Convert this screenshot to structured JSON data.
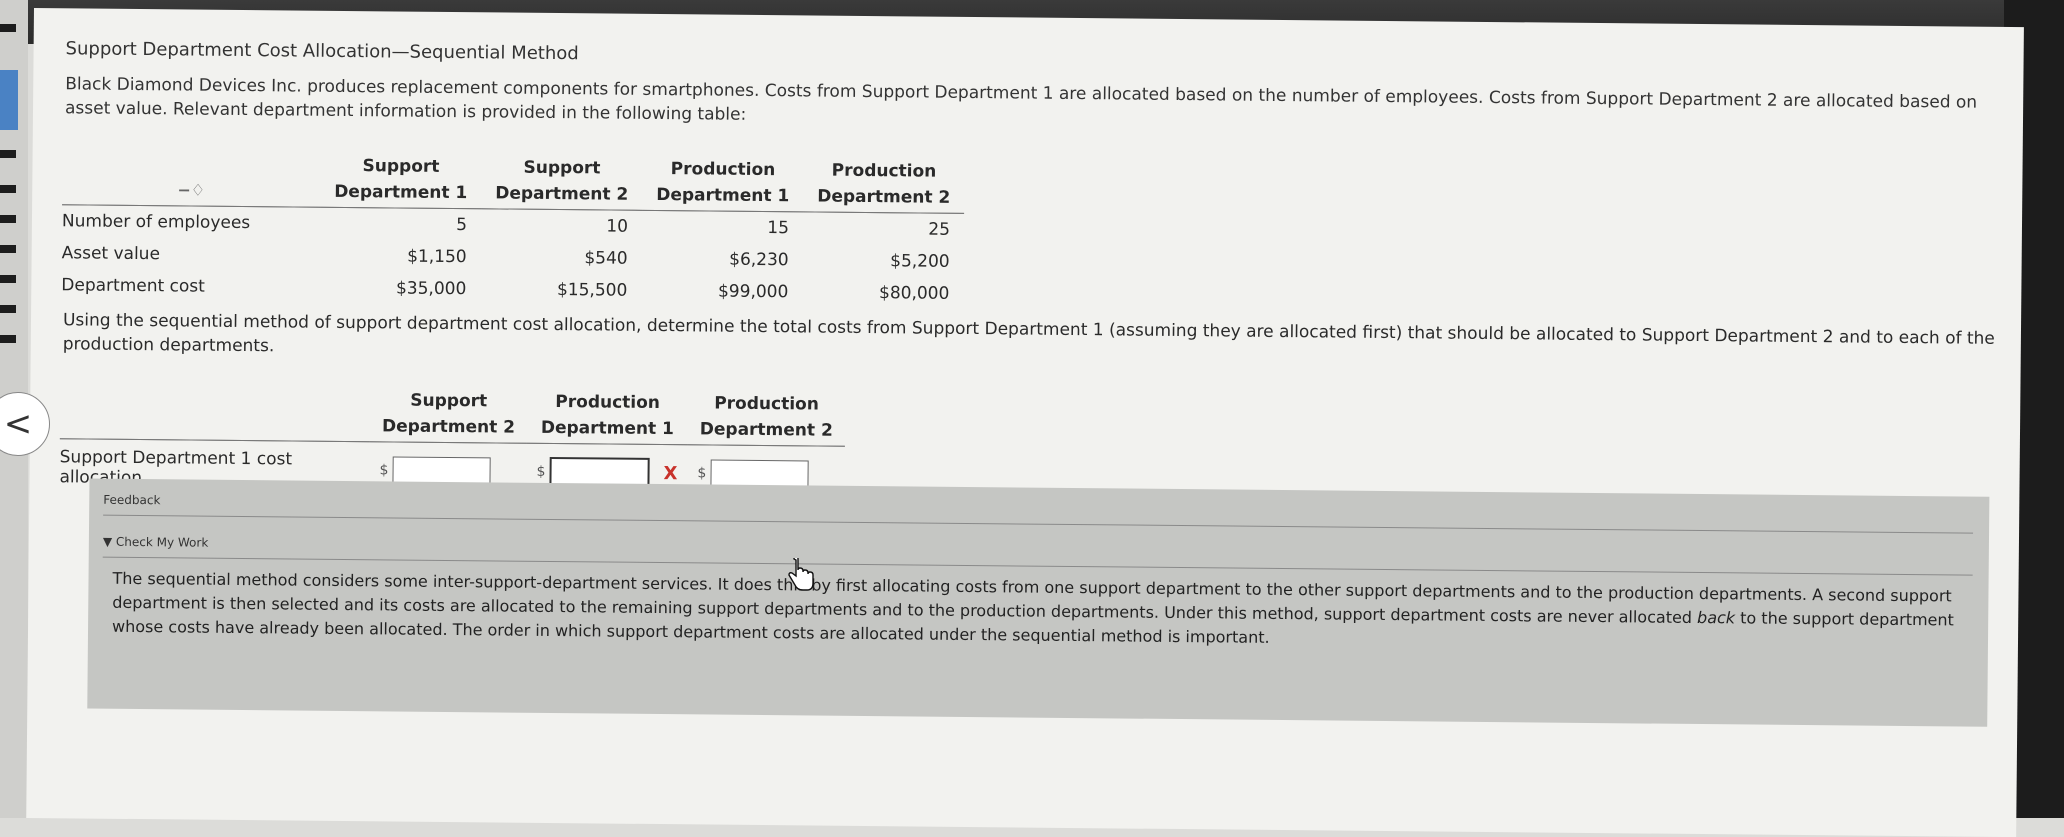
{
  "page": {
    "title": "Support Department Cost Allocation—Sequential Method",
    "intro": "Black Diamond Devices Inc. produces replacement components for smartphones. Costs from Support Department 1 are allocated based on the number of employees. Costs from Support Department 2 are allocated based on asset value. Relevant department information is provided in the following table:",
    "question": "Using the sequential method of support department cost allocation, determine the total costs from Support Department 1 (assuming they are allocated first) that should be allocated to Support Department 2 and to each of the production departments."
  },
  "info_table": {
    "pin_icon": "−♢",
    "headers": [
      {
        "line1": "Support",
        "line2": "Department 1"
      },
      {
        "line1": "Support",
        "line2": "Department 2"
      },
      {
        "line1": "Production",
        "line2": "Department 1"
      },
      {
        "line1": "Production",
        "line2": "Department 2"
      }
    ],
    "rows": [
      {
        "label": "Number of employees",
        "values": [
          "5",
          "10",
          "15",
          "25"
        ]
      },
      {
        "label": "Asset value",
        "values": [
          "$1,150",
          "$540",
          "$6,230",
          "$5,200"
        ]
      },
      {
        "label": "Department cost",
        "values": [
          "$35,000",
          "$15,500",
          "$99,000",
          "$80,000"
        ]
      }
    ]
  },
  "answer_table": {
    "headers": [
      {
        "line1": "Support",
        "line2": "Department 2"
      },
      {
        "line1": "Production",
        "line2": "Department 1"
      },
      {
        "line1": "Production",
        "line2": "Department 2"
      }
    ],
    "row_label": "Support Department 1 cost allocation",
    "currency": "$",
    "inputs": [
      {
        "value": "",
        "status": "none"
      },
      {
        "value": "",
        "status": "incorrect",
        "mark": "X"
      },
      {
        "value": "",
        "status": "none"
      }
    ]
  },
  "feedback": {
    "label": "Feedback",
    "check_my_work": "▼ Check My Work",
    "text_before": "The sequential method considers some inter-support-department services. It does this by first allocating costs from one support department to the other support departments and to the production departments. A second support department is then selected and its costs are allocated to the remaining support departments and to the production departments. Under this method, support department costs are never allocated ",
    "text_emph": "back",
    "text_after": " to the support department whose costs have already been allocated. The order in which support department costs are allocated under the sequential method is important."
  },
  "nav": {
    "back_icon": "<"
  },
  "colors": {
    "incorrect": "#c8322b",
    "feedback_bg": "#c5c6c3",
    "page_bg": "#f2f2ef"
  }
}
